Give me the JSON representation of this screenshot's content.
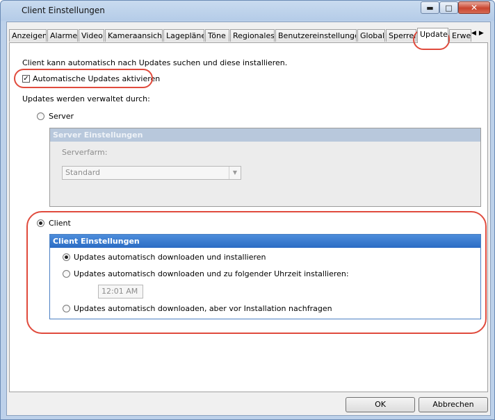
{
  "window": {
    "title": "Client Einstellungen"
  },
  "tabs": [
    "Anzeigen",
    "Alarme",
    "Video",
    "Kameraansicht",
    "Lagepläne",
    "Töne",
    "Regionales",
    "Benutzereinstellungen",
    "Global",
    "Sperren",
    "Update",
    "Erwe"
  ],
  "active_tab": "Update",
  "content": {
    "intro": "Client kann automatisch nach Updates suchen und diese installieren.",
    "auto_updates_label": "Automatische Updates aktivieren",
    "managed_by_label": "Updates werden verwaltet durch:",
    "server_radio": "Server",
    "server_group": {
      "title": "Server Einstellungen",
      "farm_label": "Serverfarm:",
      "farm_value": "Standard"
    },
    "client_radio": "Client",
    "client_group": {
      "title": "Client Einstellungen",
      "option1": "Updates automatisch downloaden und installieren",
      "option2": "Updates automatisch downloaden und zu folgender Uhrzeit installieren:",
      "time": "12:01 AM",
      "option3": "Updates automatisch downloaden, aber vor Installation nachfragen"
    }
  },
  "buttons": {
    "ok": "OK",
    "cancel": "Abbrechen"
  },
  "colors": {
    "highlight": "#e04a3c",
    "group_header": "#2b6cc4"
  }
}
